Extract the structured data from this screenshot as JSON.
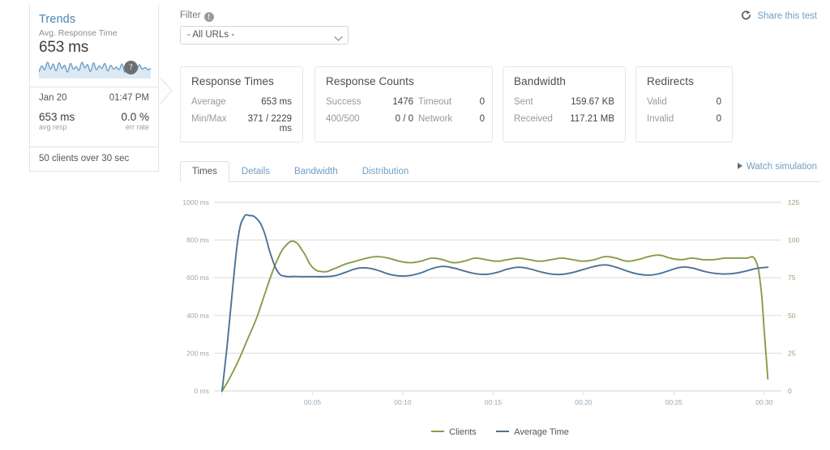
{
  "trends": {
    "title": "Trends",
    "subtitle": "Avg. Response Time",
    "big_value": "653 ms",
    "sparkline_badge": "?",
    "date": "Jan 20",
    "time": "01:47 PM",
    "avg_resp_value": "653 ms",
    "avg_resp_label": "avg resp",
    "err_rate_value": "0.0 %",
    "err_rate_label": "err rate",
    "footer": "50 clients over 30 sec"
  },
  "filter": {
    "label": "Filter",
    "badge": "!",
    "selected": "- All URLs -",
    "options": [
      "- All URLs -"
    ]
  },
  "share": {
    "label": "Share this test",
    "icon": "share-icon"
  },
  "cards": [
    {
      "title": "Response Times",
      "layout": "kv2",
      "rows": [
        {
          "key": "Average",
          "value": "653 ms"
        },
        {
          "key": "Min/Max",
          "value": "371 / 2229 ms"
        }
      ]
    },
    {
      "title": "Response Counts",
      "layout": "grid4",
      "rows": [
        {
          "key": "Success",
          "value": "1476",
          "key2": "Timeout",
          "value2": "0"
        },
        {
          "key": "400/500",
          "value": "0 / 0",
          "key2": "Network",
          "value2": "0"
        }
      ]
    },
    {
      "title": "Bandwidth",
      "layout": "kv2",
      "rows": [
        {
          "key": "Sent",
          "value": "159.67 KB"
        },
        {
          "key": "Received",
          "value": "117.21 MB"
        }
      ]
    },
    {
      "title": "Redirects",
      "layout": "kv2",
      "rows": [
        {
          "key": "Valid",
          "value": "0"
        },
        {
          "key": "Invalid",
          "value": "0"
        }
      ]
    }
  ],
  "tabs": [
    {
      "label": "Times",
      "active": true
    },
    {
      "label": "Details",
      "active": false
    },
    {
      "label": "Bandwidth",
      "active": false
    },
    {
      "label": "Distribution",
      "active": false
    }
  ],
  "watch": {
    "label": "Watch simulation",
    "icon": "play-icon"
  },
  "colors": {
    "clients": "#8a9a4a",
    "average_time": "#4a7296",
    "link": "#6f9ec4",
    "gridline": "#e4e4e4"
  },
  "chart_data": {
    "type": "line",
    "title": "",
    "xlabel": "",
    "ylabel": "",
    "grid": true,
    "legend_position": "bottom",
    "x_ticks": [
      "00:05",
      "00:10",
      "00:15",
      "00:20",
      "00:25",
      "00:30"
    ],
    "x_tick_seconds": [
      5,
      10,
      15,
      20,
      25,
      30
    ],
    "xlim": [
      0,
      30.5
    ],
    "left_axis": {
      "label": "ms",
      "ticks": [
        "0 ms",
        "200 ms",
        "400 ms",
        "600 ms",
        "800 ms",
        "1000 ms"
      ],
      "tick_values": [
        0,
        200,
        400,
        600,
        800,
        1000
      ],
      "ylim": [
        0,
        1000
      ],
      "series": "Average Time"
    },
    "right_axis": {
      "label": "clients",
      "ticks": [
        "0",
        "25",
        "50",
        "75",
        "100",
        "125"
      ],
      "tick_values": [
        0,
        25,
        50,
        75,
        100,
        125
      ],
      "ylim": [
        0,
        125
      ],
      "series": "Clients"
    },
    "series": [
      {
        "name": "Clients",
        "color": "#8a9a4a",
        "axis": "right",
        "unit": "clients",
        "x": [
          0,
          0.4,
          0.9,
          1.4,
          1.9,
          2.3,
          2.7,
          3.1,
          3.5,
          4.0,
          4.5,
          5.0,
          5.6,
          6.2,
          6.8,
          7.4,
          8.0,
          8.6,
          9.2,
          9.8,
          10.4,
          11.0,
          11.6,
          12.2,
          12.8,
          13.4,
          14.0,
          14.6,
          15.2,
          15.8,
          16.4,
          17.0,
          17.6,
          18.2,
          18.8,
          19.4,
          20.0,
          20.6,
          21.2,
          21.8,
          22.4,
          23.0,
          23.6,
          24.2,
          24.8,
          25.4,
          26.0,
          26.6,
          27.2,
          27.8,
          28.4,
          29.0,
          29.5,
          29.8,
          30.0,
          30.2
        ],
        "y": [
          0,
          8,
          20,
          34,
          48,
          62,
          76,
          88,
          96,
          99,
          92,
          82,
          79,
          81,
          84,
          86,
          88,
          89,
          88,
          86,
          85,
          86,
          88,
          87,
          85,
          86,
          88,
          87,
          86,
          87,
          88,
          87,
          86,
          87,
          88,
          87,
          86,
          87,
          89,
          88,
          86,
          87,
          89,
          90,
          88,
          87,
          88,
          87,
          87,
          88,
          88,
          88,
          87,
          70,
          40,
          8
        ]
      },
      {
        "name": "Average Time",
        "color": "#4a7296",
        "axis": "left",
        "unit": "ms",
        "x": [
          0,
          0.3,
          0.6,
          0.9,
          1.2,
          1.5,
          1.9,
          2.3,
          2.7,
          3.1,
          3.5,
          4.0,
          4.5,
          5.0,
          5.6,
          6.2,
          6.8,
          7.4,
          8.0,
          8.6,
          9.2,
          9.8,
          10.4,
          11.0,
          11.6,
          12.2,
          12.8,
          13.4,
          14.0,
          14.6,
          15.2,
          15.8,
          16.4,
          17.0,
          17.6,
          18.2,
          18.8,
          19.4,
          20.0,
          20.6,
          21.2,
          21.8,
          22.4,
          23.0,
          23.6,
          24.2,
          24.8,
          25.4,
          26.0,
          26.6,
          27.2,
          27.8,
          28.4,
          29.0,
          29.6,
          30.2
        ],
        "y": [
          0,
          260,
          560,
          820,
          920,
          930,
          915,
          850,
          720,
          630,
          608,
          607,
          606,
          606,
          606,
          610,
          628,
          648,
          652,
          640,
          620,
          610,
          612,
          626,
          648,
          660,
          652,
          636,
          622,
          618,
          628,
          646,
          656,
          648,
          632,
          620,
          618,
          628,
          644,
          660,
          668,
          656,
          636,
          620,
          614,
          622,
          640,
          656,
          652,
          636,
          624,
          620,
          624,
          636,
          650,
          656
        ]
      }
    ],
    "legend": [
      {
        "label": "Clients",
        "color": "#8a9a4a"
      },
      {
        "label": "Average Time",
        "color": "#4a7296"
      }
    ]
  },
  "sparkline": {
    "points": [
      640,
      660,
      648,
      672,
      650,
      666,
      644,
      670,
      652,
      662,
      640,
      668,
      650,
      658,
      646,
      672,
      654,
      664,
      642,
      670,
      648,
      660,
      652,
      668,
      644,
      662,
      650,
      656,
      648,
      666,
      640,
      670,
      652,
      658,
      646,
      664,
      650,
      655,
      648,
      652
    ],
    "color": "#6f9ec4",
    "fill": "#dce9f2"
  }
}
